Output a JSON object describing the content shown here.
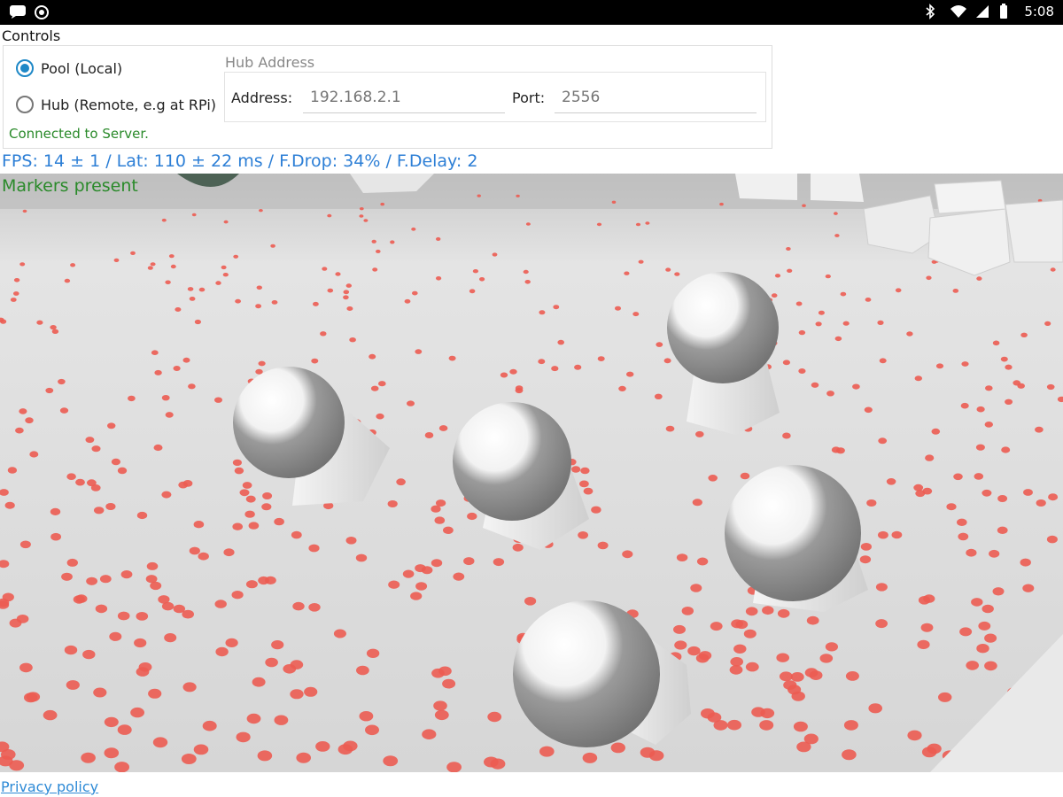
{
  "status_bar": {
    "time": "5:08",
    "left_icons": [
      "message-icon",
      "target-icon"
    ],
    "right_icons": [
      "bluetooth-icon",
      "wifi-icon",
      "signal-icon",
      "battery-icon"
    ]
  },
  "controls": {
    "title": "Controls",
    "options": [
      {
        "label": "Pool (Local)",
        "checked": true
      },
      {
        "label": "Hub (Remote, e.g at RPi)",
        "checked": false
      }
    ],
    "status": "Connected to Server.",
    "hub": {
      "title": "Hub Address",
      "address_label": "Address:",
      "address_placeholder": "192.168.2.1",
      "port_label": "Port:",
      "port_placeholder": "2556"
    }
  },
  "stats": {
    "fps_line": "FPS: 14 ± 1 / Lat: 110 ± 22 ms / F.Drop: 34% / F.Delay: 2"
  },
  "camera": {
    "markers_status": "Markers present",
    "sphere_count": 5,
    "dot_color": "#ec5c52"
  },
  "footer": {
    "privacy_link": "Privacy policy"
  },
  "colors": {
    "accent": "#1e88c7",
    "success": "#2a8a2a",
    "stats": "#2d7fd6"
  }
}
